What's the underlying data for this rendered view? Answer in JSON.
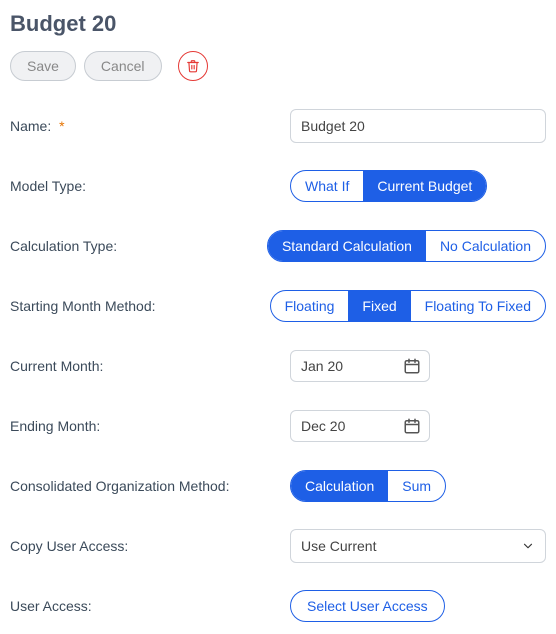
{
  "header": {
    "title": "Budget 20"
  },
  "toolbar": {
    "save_label": "Save",
    "cancel_label": "Cancel"
  },
  "form": {
    "name": {
      "label": "Name:",
      "required": "*",
      "value": "Budget 20"
    },
    "model_type": {
      "label": "Model Type:",
      "options": [
        "What If",
        "Current Budget"
      ],
      "selected": "Current Budget"
    },
    "calc_type": {
      "label": "Calculation Type:",
      "options": [
        "Standard Calculation",
        "No Calculation"
      ],
      "selected": "Standard Calculation"
    },
    "start_month_method": {
      "label": "Starting Month Method:",
      "options": [
        "Floating",
        "Fixed",
        "Floating To Fixed"
      ],
      "selected": "Fixed"
    },
    "current_month": {
      "label": "Current Month:",
      "value": "Jan 20"
    },
    "ending_month": {
      "label": "Ending Month:",
      "value": "Dec 20"
    },
    "consolidated_method": {
      "label": "Consolidated Organization Method:",
      "options": [
        "Calculation",
        "Sum"
      ],
      "selected": "Calculation"
    },
    "copy_user_access": {
      "label": "Copy User Access:",
      "value": "Use Current"
    },
    "user_access": {
      "label": "User Access:",
      "button": "Select User Access"
    }
  },
  "colors": {
    "accent": "#1e5fe6",
    "danger": "#e53935"
  }
}
